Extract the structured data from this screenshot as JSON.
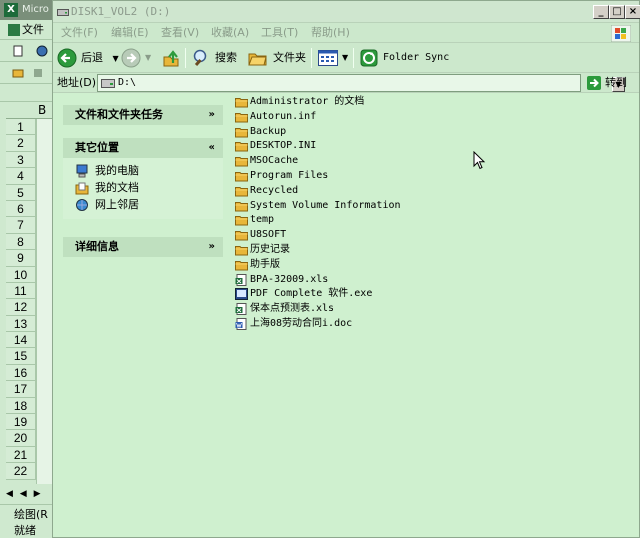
{
  "background_app": {
    "title": "Micro",
    "menu_first": "文件",
    "column_b": "B",
    "rows": [
      "1",
      "2",
      "3",
      "4",
      "5",
      "6",
      "7",
      "8",
      "9",
      "10",
      "11",
      "12",
      "13",
      "14",
      "15",
      "16",
      "17",
      "18",
      "19",
      "20",
      "21",
      "22"
    ],
    "sheet_nav": "◀ ◀ ▶",
    "draw_label": "绘图(R",
    "status_label": "就绪"
  },
  "window": {
    "title": "DISK1_VOL2 (D:)"
  },
  "menu": {
    "items": [
      "文件(F)",
      "编辑(E)",
      "查看(V)",
      "收藏(A)",
      "工具(T)",
      "帮助(H)"
    ]
  },
  "toolbar": {
    "back_label": "后退",
    "search_label": "搜索",
    "folders_label": "文件夹",
    "folder_sync_label": "Folder Sync"
  },
  "address": {
    "label": "地址(D)",
    "value": "D:\\",
    "go_label": "转到"
  },
  "panes": [
    {
      "title": "文件和文件夹任务",
      "chevron": "»",
      "links": []
    },
    {
      "title": "其它位置",
      "chevron": "«",
      "links": [
        "我的电脑",
        "我的文档",
        "网上邻居"
      ]
    },
    {
      "title": "详细信息",
      "chevron": "»",
      "links": []
    }
  ],
  "files": [
    {
      "name": "Administrator 的文档",
      "type": "folder"
    },
    {
      "name": "Autorun.inf",
      "type": "folder"
    },
    {
      "name": "Backup",
      "type": "folder"
    },
    {
      "name": "DESKTOP.INI",
      "type": "folder"
    },
    {
      "name": "MSOCache",
      "type": "folder"
    },
    {
      "name": "Program Files",
      "type": "folder"
    },
    {
      "name": "Recycled",
      "type": "folder"
    },
    {
      "name": "System Volume Information",
      "type": "folder"
    },
    {
      "name": "temp",
      "type": "folder"
    },
    {
      "name": "U8SOFT",
      "type": "folder"
    },
    {
      "name": "历史记录",
      "type": "folder"
    },
    {
      "name": "助手版",
      "type": "folder"
    },
    {
      "name": "BPA-32009.xls",
      "type": "xls"
    },
    {
      "name": "PDF Complete 软件.exe",
      "type": "exe"
    },
    {
      "name": "保本点预测表.xls",
      "type": "xls"
    },
    {
      "name": "上海08劳动合同i.doc",
      "type": "doc"
    }
  ],
  "colors": {
    "accent": "#cce8cc",
    "folder": "#e8b63a",
    "go_green": "#2c9a3c"
  }
}
